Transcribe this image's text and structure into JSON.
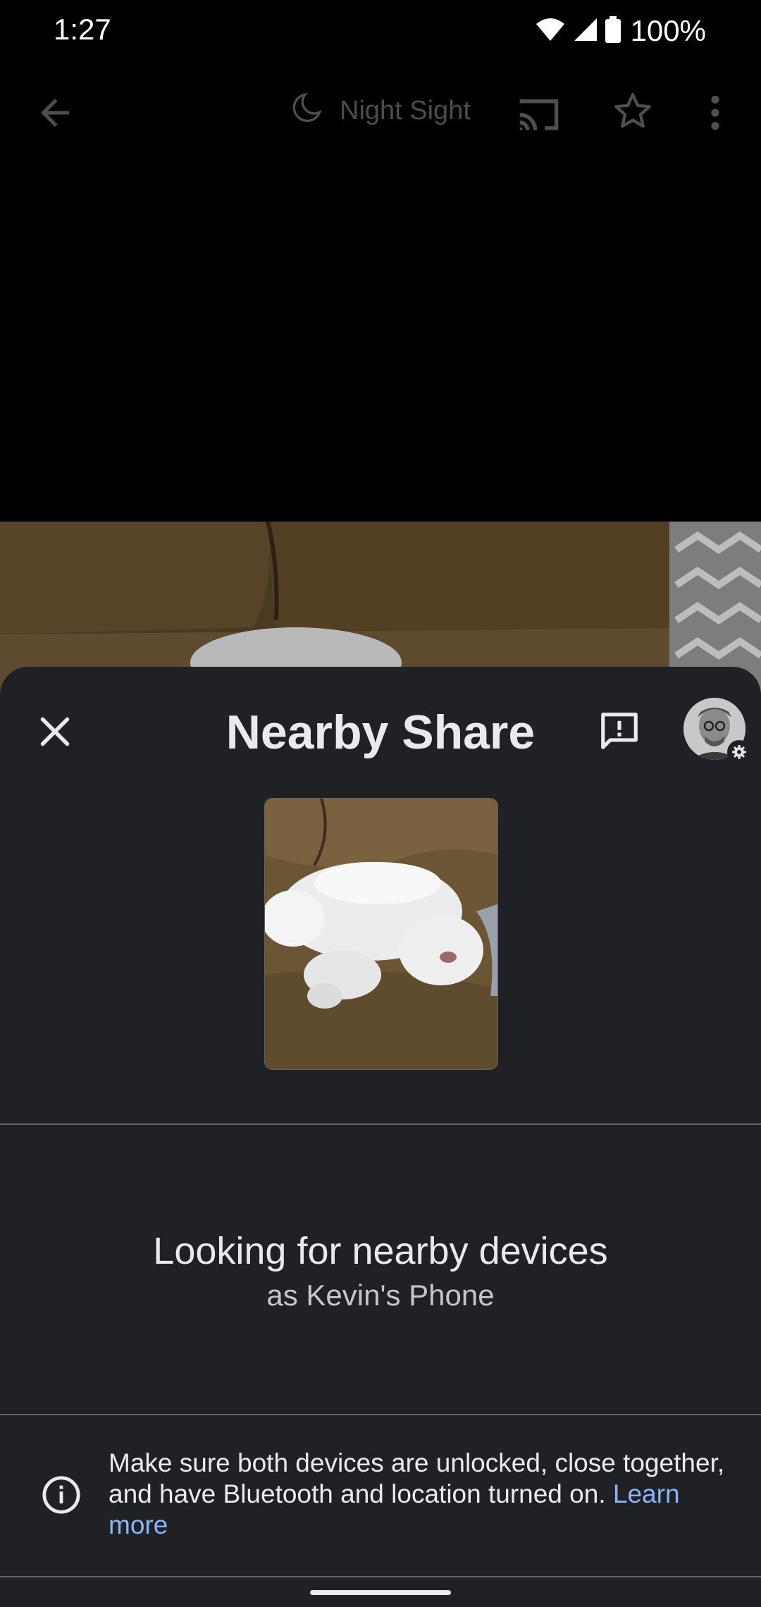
{
  "status_bar": {
    "time": "1:27",
    "battery": "100%"
  },
  "app_bar": {
    "night_sight_label": "Night Sight"
  },
  "sheet": {
    "title": "Nearby Share",
    "looking_text": "Looking for nearby devices",
    "device_name_text": "as Kevin's Phone",
    "info_text": "Make sure both devices are unlocked, close together, and have Bluetooth and location turned on. ",
    "learn_more": "Learn more"
  },
  "colors": {
    "sheet_bg": "#202124",
    "link": "#8ab4f8"
  },
  "icons": [
    "back-arrow-icon",
    "moon-icon",
    "cast-icon",
    "star-icon",
    "more-vert-icon",
    "close-icon",
    "feedback-icon",
    "settings-gear-icon",
    "info-icon"
  ]
}
